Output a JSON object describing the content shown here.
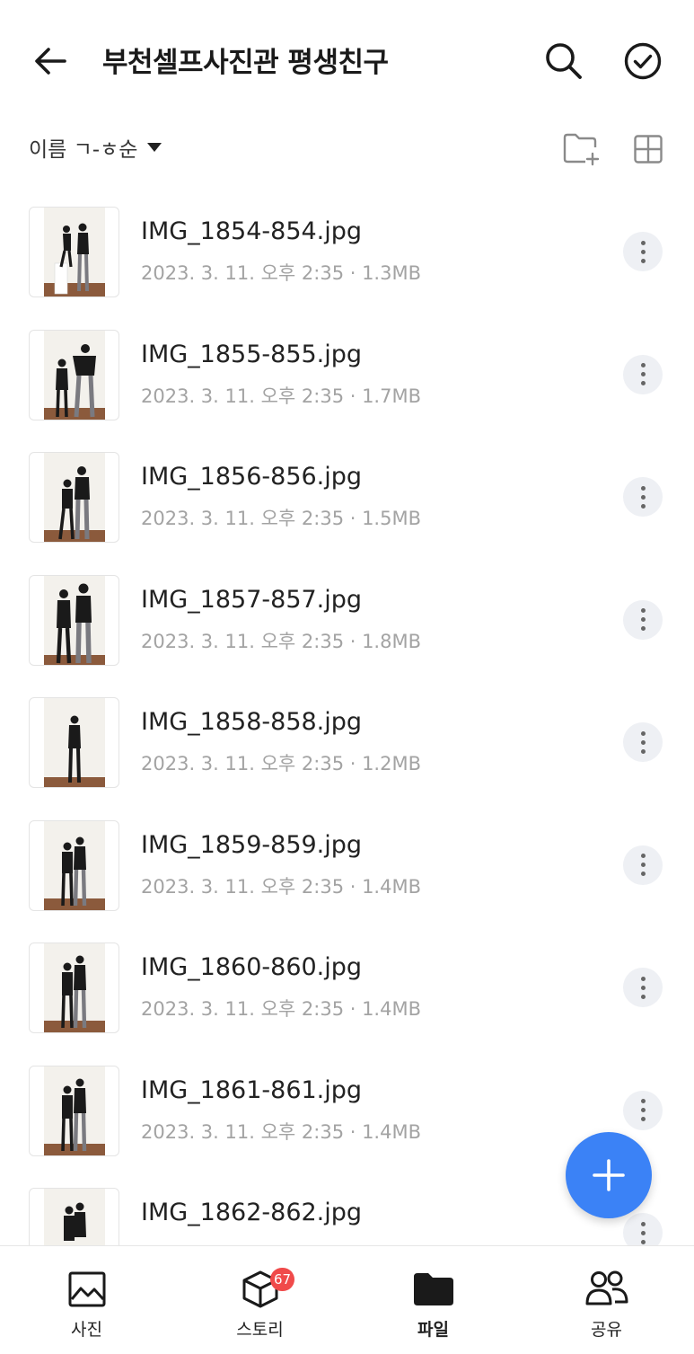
{
  "header": {
    "title": "부천셀프사진관 평생친구"
  },
  "sortbar": {
    "sort_label": "이름 ㄱ-ㅎ순"
  },
  "files": [
    {
      "name": "IMG_1854-854.jpg",
      "meta": "2023. 3. 11. 오후 2:35 · 1.3MB"
    },
    {
      "name": "IMG_1855-855.jpg",
      "meta": "2023. 3. 11. 오후 2:35 · 1.7MB"
    },
    {
      "name": "IMG_1856-856.jpg",
      "meta": "2023. 3. 11. 오후 2:35 · 1.5MB"
    },
    {
      "name": "IMG_1857-857.jpg",
      "meta": "2023. 3. 11. 오후 2:35 · 1.8MB"
    },
    {
      "name": "IMG_1858-858.jpg",
      "meta": "2023. 3. 11. 오후 2:35 · 1.2MB"
    },
    {
      "name": "IMG_1859-859.jpg",
      "meta": "2023. 3. 11. 오후 2:35 · 1.4MB"
    },
    {
      "name": "IMG_1860-860.jpg",
      "meta": "2023. 3. 11. 오후 2:35 · 1.4MB"
    },
    {
      "name": "IMG_1861-861.jpg",
      "meta": "2023. 3. 11. 오후 2:35 · 1.4MB"
    },
    {
      "name": "IMG_1862-862.jpg",
      "meta": ""
    }
  ],
  "bottom_nav": {
    "photos": "사진",
    "stories": "스토리",
    "stories_badge": "67",
    "files": "파일",
    "share": "공유"
  },
  "colors": {
    "accent": "#3b82f6",
    "badge": "#f04a4a"
  }
}
